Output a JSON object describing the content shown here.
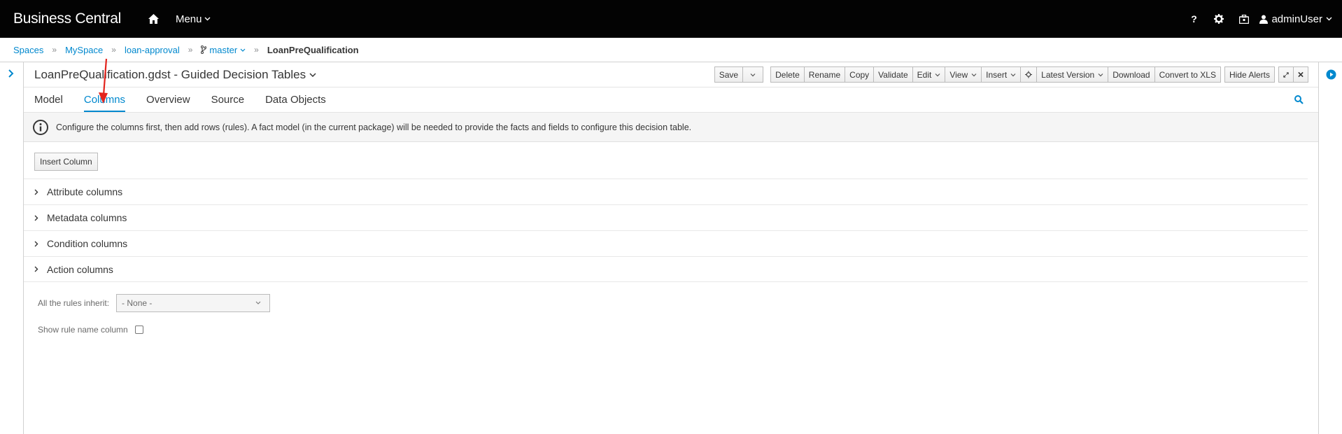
{
  "navbar": {
    "brand": "Business Central",
    "menu_label": "Menu",
    "help_label": "?",
    "user_label": "adminUser"
  },
  "breadcrumb": {
    "items": [
      "Spaces",
      "MySpace",
      "loan-approval"
    ],
    "branch": "master",
    "current": "LoanPreQualification",
    "separator": "»"
  },
  "editor": {
    "title": "LoanPreQualification.gdst - Guided Decision Tables",
    "toolbar": {
      "save": "Save",
      "delete": "Delete",
      "rename": "Rename",
      "copy": "Copy",
      "validate": "Validate",
      "edit": "Edit",
      "view": "View",
      "insert": "Insert",
      "latest_version": "Latest Version",
      "download": "Download",
      "convert_to_xls": "Convert to XLS",
      "hide_alerts": "Hide Alerts"
    },
    "tabs": [
      "Model",
      "Columns",
      "Overview",
      "Source",
      "Data Objects"
    ],
    "active_tab": "Columns",
    "alert_text": "Configure the columns first, then add rows (rules). A fact model (in the current package) will be needed to provide the facts and fields to configure this decision table.",
    "insert_column": "Insert Column",
    "sections": [
      "Attribute columns",
      "Metadata columns",
      "Condition columns",
      "Action columns"
    ],
    "inherit_label": "All the rules inherit:",
    "inherit_value": "- None -",
    "rule_name_label": "Show rule name column",
    "rule_name_checked": false
  },
  "colors": {
    "navbar_bg": "#030303",
    "link": "#0088ce",
    "annotation": "#e3241d"
  },
  "icons": {
    "home": "home-icon",
    "settings": "gear-icon",
    "briefcase": "briefcase-icon",
    "user": "user-icon",
    "search": "search-icon",
    "info": "info-icon",
    "expand": "expand-icon",
    "close": "close-icon"
  }
}
